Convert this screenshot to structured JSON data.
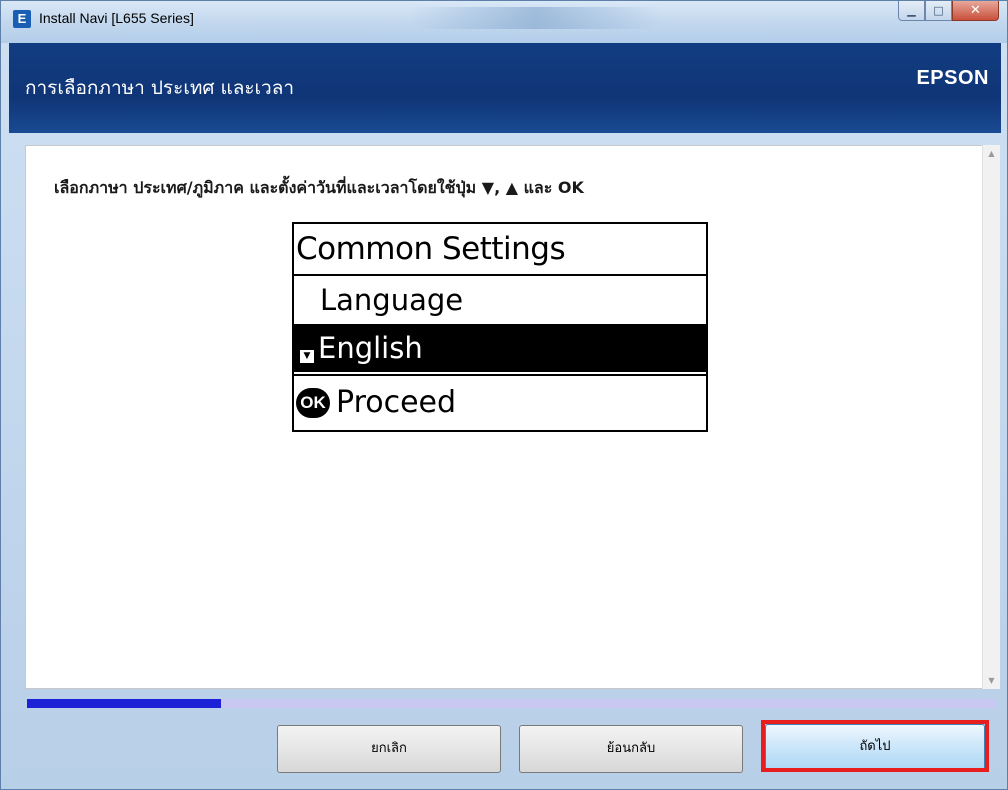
{
  "window": {
    "title": "Install Navi [L655 Series]",
    "app_icon_letter": "E"
  },
  "header": {
    "title": "การเลือกภาษา ประเทศ และเวลา",
    "brand": "EPSON"
  },
  "content": {
    "instruction": "เลือกภาษา ประเทศ/ภูมิภาค และตั้งค่าวันที่และเวลาโดยใช้ปุ่ม ▼, ▲ และ OK",
    "lcd": {
      "header": "Common Settings",
      "item": "Language",
      "selected": "English",
      "ok_label": "OK",
      "footer": "Proceed"
    }
  },
  "progress": {
    "fraction": 0.2
  },
  "buttons": {
    "cancel": "ยกเลิก",
    "back": "ย้อนกลับ",
    "next": "ถัดไป"
  },
  "colors": {
    "header_bg": "#123d82",
    "progress_fill": "#1e22d6",
    "progress_track": "#c9c8f2",
    "highlight": "#e81e1e"
  }
}
